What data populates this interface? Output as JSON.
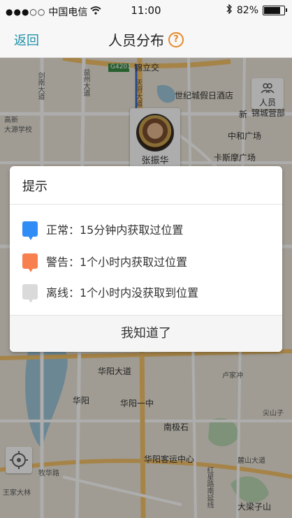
{
  "status_bar": {
    "signal_dots": "●●●○○",
    "carrier": "中国电信",
    "time": "11:00",
    "battery": "82%",
    "icons": [
      "wifi-icon",
      "bluetooth-icon",
      "battery-icon"
    ]
  },
  "nav": {
    "back_label": "返回",
    "title": "人员分布",
    "help_label": "?"
  },
  "map": {
    "labels": [
      "G4201",
      "锦立交",
      "天府大道",
      "世纪城假日酒店",
      "剑南大道",
      "益州大道",
      "新",
      "锦城营部",
      "中和广场",
      "卡斯摩广场",
      "高新",
      "大源学校",
      "华阳大道",
      "卢家冲",
      "华阳",
      "华阳一中",
      "南极石",
      "华阳客运中心",
      "牧华路",
      "王家大林",
      "大梁子山",
      "尖山子",
      "红星路南延线",
      "麓山大道"
    ],
    "people_button_label": "人员",
    "person": {
      "name": "张振华"
    }
  },
  "dialog": {
    "title": "提示",
    "legend": [
      {
        "color": "#2f8df5",
        "text": "正常：15分钟内获取过位置"
      },
      {
        "color": "#f7804e",
        "text": "警告：1个小时内获取过位置"
      },
      {
        "color": "#dadada",
        "text": "离线：1个小时内没获取到位置"
      }
    ],
    "confirm_label": "我知道了"
  }
}
